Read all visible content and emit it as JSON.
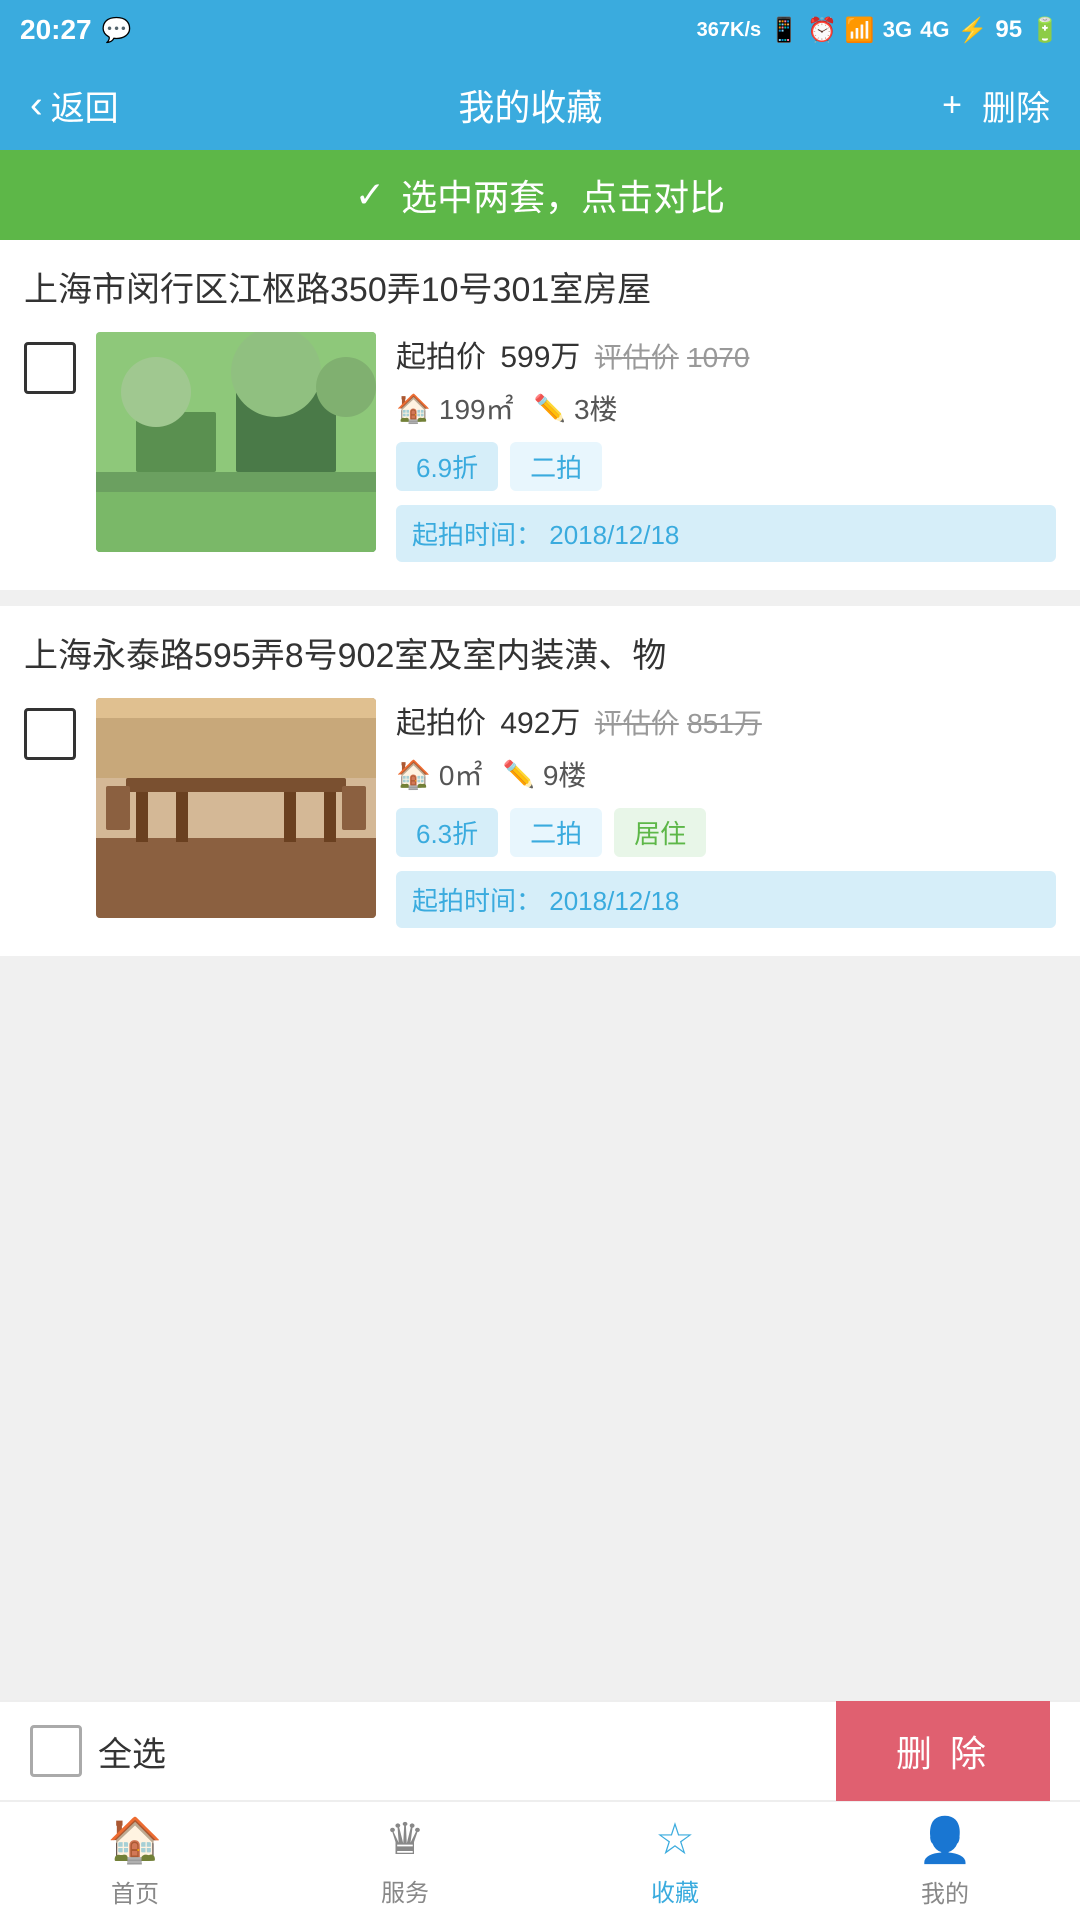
{
  "statusBar": {
    "time": "20:27",
    "speed": "367K/s",
    "battery": "95"
  },
  "navBar": {
    "backLabel": "返回",
    "title": "我的收藏",
    "plusLabel": "+",
    "deleteLabel": "删除"
  },
  "compareBanner": {
    "icon": "✓",
    "label": "选中两套，点击对比"
  },
  "properties": [
    {
      "id": "prop1",
      "title": "上海市闵行区江枢路350弄10号301室房屋",
      "startBidLabel": "起拍价",
      "startBidValue": "599万",
      "estimateLabel": "评估价",
      "estimateValue": "1070",
      "areaIcon": "🏠",
      "area": "199㎡",
      "floorIcon": "✏",
      "floor": "3楼",
      "tags": [
        {
          "label": "6.9折",
          "type": "blue"
        },
        {
          "label": "二拍",
          "type": "light-blue"
        }
      ],
      "auctionTimeLabel": "起拍时间：",
      "auctionTime": "2018/12/18"
    },
    {
      "id": "prop2",
      "title": "上海永泰路595弄8号902室及室内装潢、物",
      "startBidLabel": "起拍价",
      "startBidValue": "492万",
      "estimateLabel": "评估价",
      "estimateValue": "851万",
      "areaIcon": "🏠",
      "area": "0㎡",
      "floorIcon": "✏",
      "floor": "9楼",
      "tags": [
        {
          "label": "6.3折",
          "type": "blue"
        },
        {
          "label": "二拍",
          "type": "light-blue"
        },
        {
          "label": "居住",
          "type": "light-green"
        }
      ],
      "auctionTimeLabel": "起拍时间：",
      "auctionTime": "2018/12/18"
    }
  ],
  "bottomBar": {
    "selectAllLabel": "全选",
    "deleteLabel": "删 除"
  },
  "tabBar": {
    "tabs": [
      {
        "id": "home",
        "icon": "🏠",
        "label": "首页",
        "active": false
      },
      {
        "id": "service",
        "icon": "👑",
        "label": "服务",
        "active": false
      },
      {
        "id": "favorites",
        "icon": "☆",
        "label": "收藏",
        "active": true
      },
      {
        "id": "mine",
        "icon": "👤",
        "label": "我的",
        "active": false
      }
    ]
  }
}
